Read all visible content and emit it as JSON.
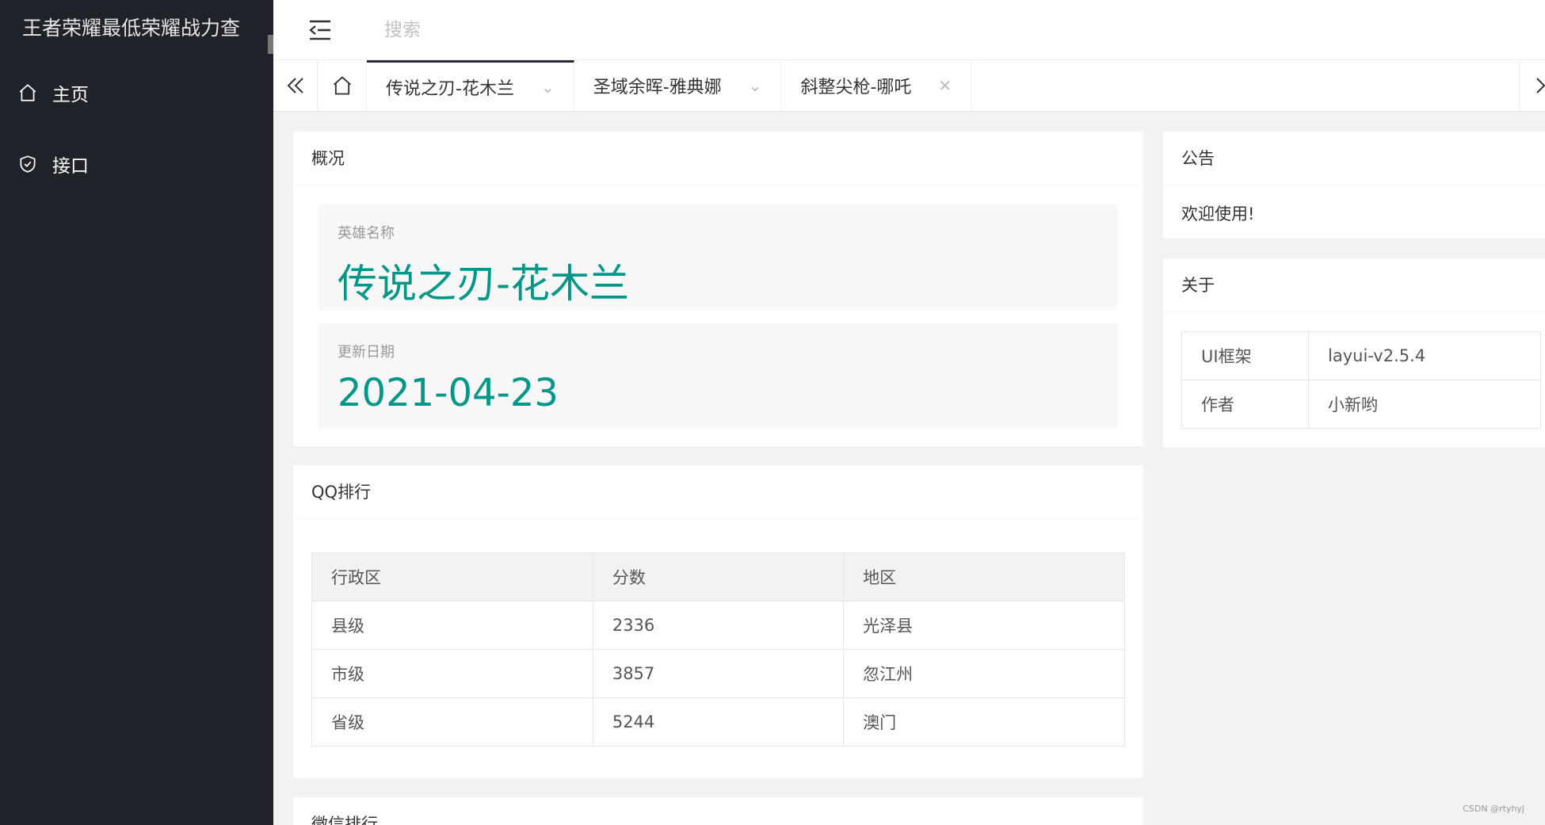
{
  "app": {
    "title": "王者荣耀最低荣耀战力查"
  },
  "sidebar": {
    "items": [
      {
        "label": "主页",
        "icon": "home-icon"
      },
      {
        "label": "接口",
        "icon": "shield-icon"
      }
    ]
  },
  "header": {
    "search_placeholder": "搜索"
  },
  "tabs": [
    {
      "label": "传说之刃-花木兰"
    },
    {
      "label": "圣域余晖-雅典娜"
    },
    {
      "label": "斜整尖枪-哪吒"
    }
  ],
  "overview": {
    "title": "概况",
    "hero_label": "英雄名称",
    "hero_value": "传说之刃-花木兰",
    "date_label": "更新日期",
    "date_value": "2021-04-23"
  },
  "qq_ranking": {
    "title": "QQ排行",
    "columns": [
      "行政区",
      "分数",
      "地区"
    ],
    "rows": [
      [
        "县级",
        "2336",
        "光泽县"
      ],
      [
        "市级",
        "3857",
        "忽江州"
      ],
      [
        "省级",
        "5244",
        "澳门"
      ]
    ]
  },
  "wechat_ranking": {
    "title": "微信排行"
  },
  "notice": {
    "title": "公告",
    "text": "欢迎使用!"
  },
  "about": {
    "title": "关于",
    "rows": [
      [
        "UI框架",
        "layui-v2.5.4"
      ],
      [
        "作者",
        "小新哟"
      ]
    ]
  },
  "watermark": "CSDN @rtyhyj",
  "colors": {
    "sidebar": "#20222a",
    "accent": "#009688"
  }
}
